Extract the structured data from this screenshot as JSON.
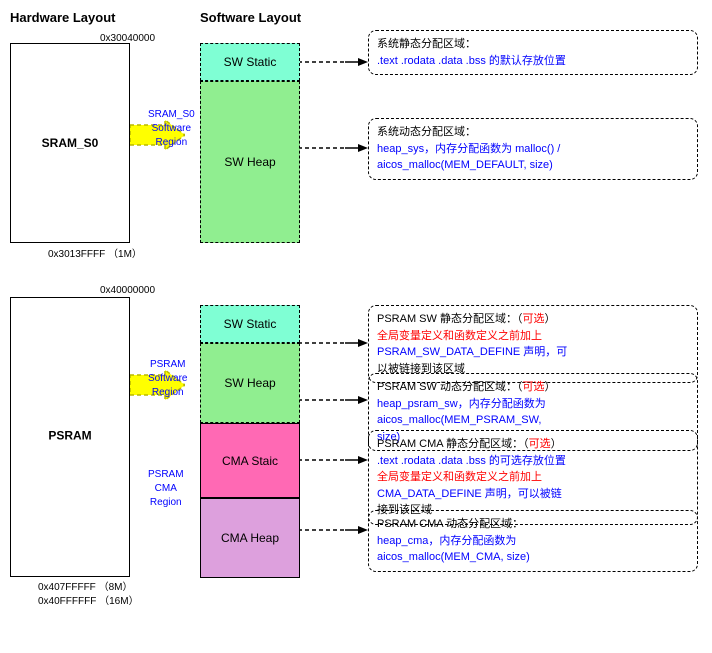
{
  "titles": {
    "hardware": "Hardware Layout",
    "software": "Software Layout"
  },
  "hardware": {
    "sram": {
      "label": "SRAM_S0",
      "addr_top": "0x30040000",
      "addr_bottom": "0x3013FFFF  （1M）",
      "region_label": "SRAM_S0\nSoftware\nRegion"
    },
    "psram": {
      "label": "PSRAM",
      "addr_top": "0x40000000",
      "addr_bottom_1": "0x407FFFFF  （8M）",
      "addr_bottom_2": "0x40FFFFFF  （16M）",
      "region_label": "PSRAM\nSoftware\nRegion",
      "cma_label": "PSRAM\nCMA\nRegion"
    }
  },
  "software": {
    "sram": {
      "blocks": [
        {
          "label": "SW Static",
          "color": "#7fffd4"
        },
        {
          "label": "SW Heap",
          "color": "#90ee90"
        }
      ]
    },
    "psram": {
      "blocks": [
        {
          "label": "SW Static",
          "color": "#7fffd4"
        },
        {
          "label": "SW Heap",
          "color": "#90ee90"
        },
        {
          "label": "CMA Staic",
          "color": "#ff69b4"
        },
        {
          "label": "CMA Heap",
          "color": "#dda0dd"
        }
      ]
    }
  },
  "descriptions": {
    "sram_static": {
      "text_black1": "系统静态分配区域：",
      "text_blue": ".text .rodata .data .bss 的默认存放位置"
    },
    "sram_heap": {
      "text_black1": "系统动态分配区域：",
      "text_blue": "heap_sys，内存分配函数为 malloc() /",
      "text_blue2": "aicos_malloc(MEM_DEFAULT, size)"
    },
    "psram_static": {
      "text_black1": "PSRAM SW 静态分配区域：（",
      "text_red": "可选",
      "text_black2": "）",
      "text_red2": "全局变量定义和函数定义之前加上",
      "text_blue": "PSRAM_SW_DATA_DEFINE 声明，可",
      "text_black3": "以被链接到该区域"
    },
    "psram_heap": {
      "text_black1": "PSRAM SW 动态分配区域：（",
      "text_red": "可选",
      "text_black2": "）",
      "text_blue": "heap_psram_sw，内存分配函数为",
      "text_blue2": "aicos_malloc(MEM_PSRAM_SW,",
      "text_blue3": "size)"
    },
    "psram_cma_static": {
      "text_black1": "PSRAM CMA 静态分配区域：（",
      "text_red": "可选",
      "text_black2": "）",
      "text_blue": ".text .rodata .data .bss 的可选存放位置",
      "text_red2": "全局变量定义和函数定义之前加上",
      "text_blue2": "CMA_DATA_DEFINE 声明，可以被链",
      "text_black3": "接到该区域"
    },
    "psram_cma_heap": {
      "text_black1": "PSRAM CMA 动态分配区域：",
      "text_blue": "heap_cma，内存分配函数为",
      "text_blue2": "aicos_malloc(MEM_CMA, size)"
    }
  }
}
